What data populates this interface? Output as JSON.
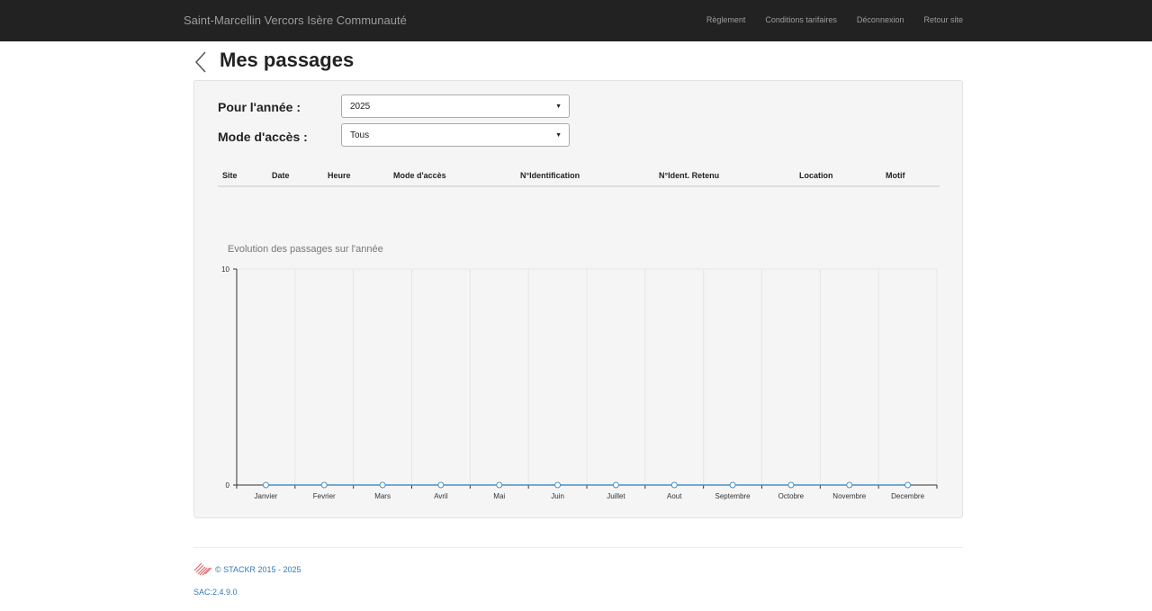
{
  "navbar": {
    "brand": "Saint-Marcellin Vercors Isère Communauté",
    "links": [
      "Règlement",
      "Conditions tarifaires",
      "Déconnexion",
      "Retour site"
    ]
  },
  "page": {
    "title": "Mes passages"
  },
  "filters": {
    "year_label": "Pour l'année :",
    "year_value": "2025",
    "mode_label": "Mode d'accès :",
    "mode_value": "Tous"
  },
  "table": {
    "columns": [
      "Site",
      "Date",
      "Heure",
      "Mode d'accès",
      "N°Identification",
      "N°Ident. Retenu",
      "Location",
      "Motif"
    ],
    "rows": []
  },
  "chart_data": {
    "type": "line",
    "title": "Evolution des passages sur l'année",
    "categories": [
      "Janvier",
      "Fevrier",
      "Mars",
      "Avril",
      "Mai",
      "Juin",
      "Juillet",
      "Aout",
      "Septembre",
      "Octobre",
      "Novembre",
      "Decembre"
    ],
    "series": [
      {
        "values": [
          0,
          0,
          0,
          0,
          0,
          0,
          0,
          0,
          0,
          0,
          0,
          0
        ]
      }
    ],
    "ylim": [
      0,
      10
    ],
    "yticks": [
      "0",
      "10"
    ],
    "grid": true,
    "colors": {
      "line": "#4a90c8",
      "point_fill": "#ffffff"
    }
  },
  "footer": {
    "copyright": "© STACKR 2015 - 2025",
    "version": "SAC:2.4.9.0"
  }
}
